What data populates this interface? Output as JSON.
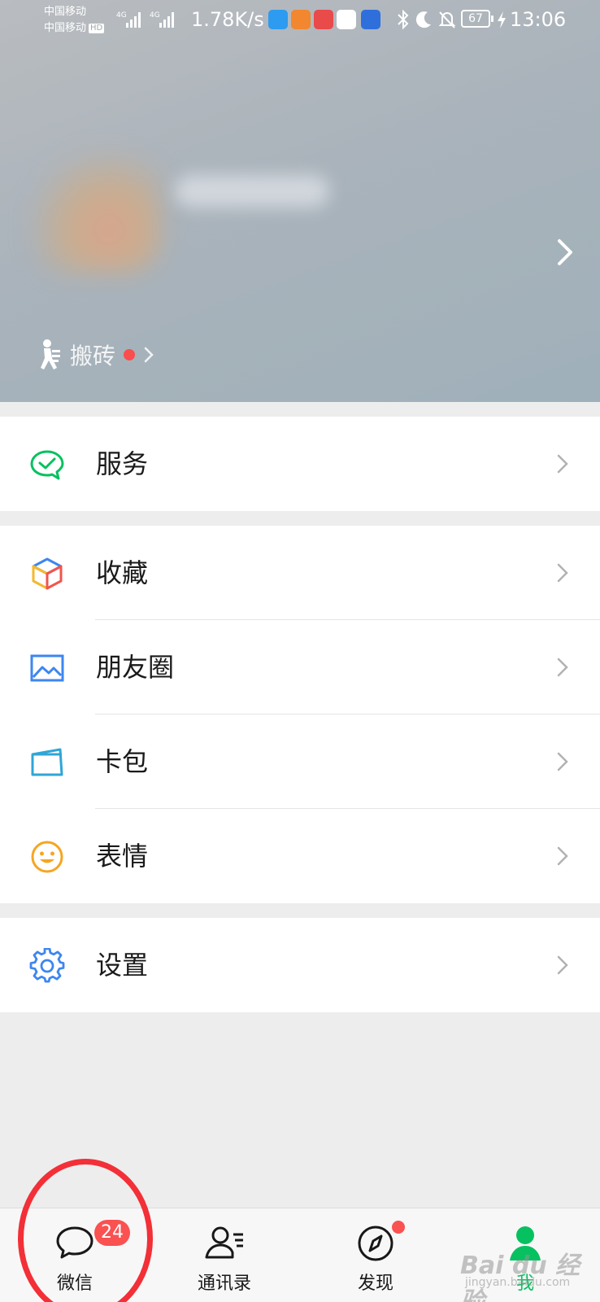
{
  "status_bar": {
    "carrier_1": "中国移动",
    "carrier_2": "中国移动",
    "hd": "HD",
    "net_1": "4G",
    "net_2": "4G",
    "speed": "1.78K/s",
    "battery": "67",
    "time": "13:06"
  },
  "profile": {
    "status_label": "搬砖"
  },
  "menu": {
    "service": "服务",
    "favorites": "收藏",
    "moments": "朋友圈",
    "cards": "卡包",
    "stickers": "表情",
    "settings": "设置"
  },
  "tabbar": {
    "chats": "微信",
    "chats_badge": "24",
    "contacts": "通讯录",
    "discover": "发现",
    "me": "我"
  },
  "watermark": {
    "text": "Bai du 经验",
    "sub": "jingyan.baidu.com"
  },
  "colors": {
    "accent": "#07c160",
    "badge": "#fa5151",
    "annotation_circle": "#f32f37"
  }
}
